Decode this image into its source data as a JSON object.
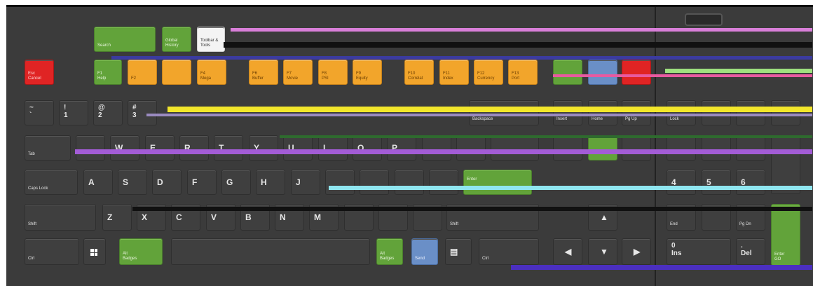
{
  "keys": {
    "esc": "Esc\nCancel",
    "f1": "F1\nHelp",
    "f2": "F2",
    "f4": "F4\nMega",
    "f6": "F6\nBuffer",
    "f7": "F7\nMovie",
    "f8": "F8\nPSI",
    "f9": "F9\nEquity",
    "f10": "F10\nCorrelat",
    "f11": "F11\nIndex",
    "f12": "F12\nCurrency",
    "f13": "F13\nPort",
    "search": "Search",
    "global_history": "Global\nHistory",
    "tooltip": "Toolbar &\nTools",
    "tilde": "~\n`",
    "one": "!\n1",
    "two": "@\n2",
    "three": "#\n3",
    "backspace": "Backspace",
    "insert": "Insert",
    "home": "Home",
    "pgup": "Pg Up",
    "lock": "Lock",
    "tab": "Tab",
    "caps": "Caps Lock",
    "shift_l": "Shift",
    "shift_r": "Shift",
    "ctrl_l": "Ctrl",
    "ctrl_r": "Ctrl",
    "alt_l": "Alt\nBadges",
    "alt_r": "Alt\nBadges",
    "send": "Send",
    "enter": "Enter",
    "numenter": "Enter\nGO",
    "end": "End",
    "pgdn": "Pg Dn",
    "np4": "4",
    "np5": "5",
    "np6": "6",
    "np0": "0\nIns",
    "npdot": ".\nDel",
    "row_q": [
      "W",
      "E",
      "R",
      "T",
      "Y",
      "U",
      "I",
      "O",
      "P"
    ],
    "row_a": [
      "A",
      "S",
      "D",
      "F",
      "G",
      "H",
      "J"
    ],
    "row_z": [
      "Z",
      "X",
      "C",
      "V",
      "B",
      "N",
      "M"
    ]
  }
}
